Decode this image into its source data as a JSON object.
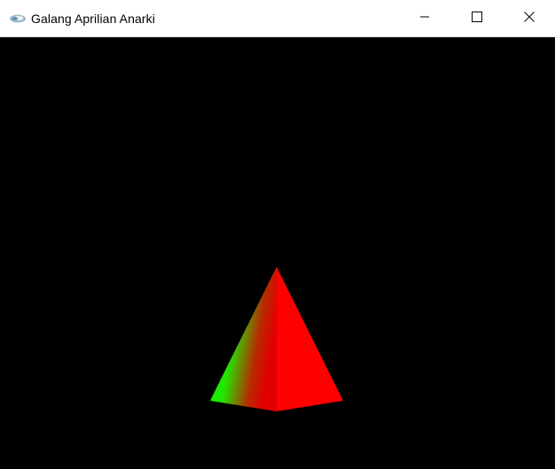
{
  "window": {
    "title": "Galang Aprilian Anarki"
  },
  "icons": {
    "app": "opengl-app-icon",
    "minimize": "minimize-icon",
    "maximize": "maximize-icon",
    "close": "close-icon"
  },
  "scene": {
    "background": "#000000",
    "shape": "pyramid",
    "face_colors": [
      "#ff0000",
      "#00ff00"
    ]
  }
}
